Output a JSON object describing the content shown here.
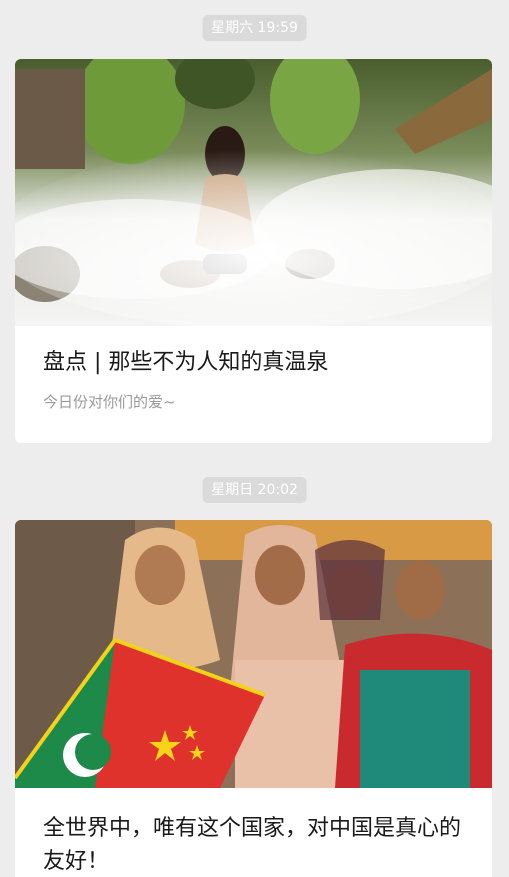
{
  "messages": [
    {
      "timestamp": "星期六 19:59",
      "title": "盘点 | 那些不为人知的真温泉",
      "subtitle": "今日份对你们的爱~",
      "image": "hot-spring-photo"
    },
    {
      "timestamp": "星期日 20:02",
      "title": "全世界中，唯有这个国家，对中国是真心的友好！",
      "image": "girls-with-flag-photo"
    }
  ],
  "colors": {
    "background": "#ededed",
    "card": "#ffffff",
    "timestamp_bg": "#dadada",
    "title": "#1a1a1a",
    "subtitle": "#9a9a9a"
  }
}
